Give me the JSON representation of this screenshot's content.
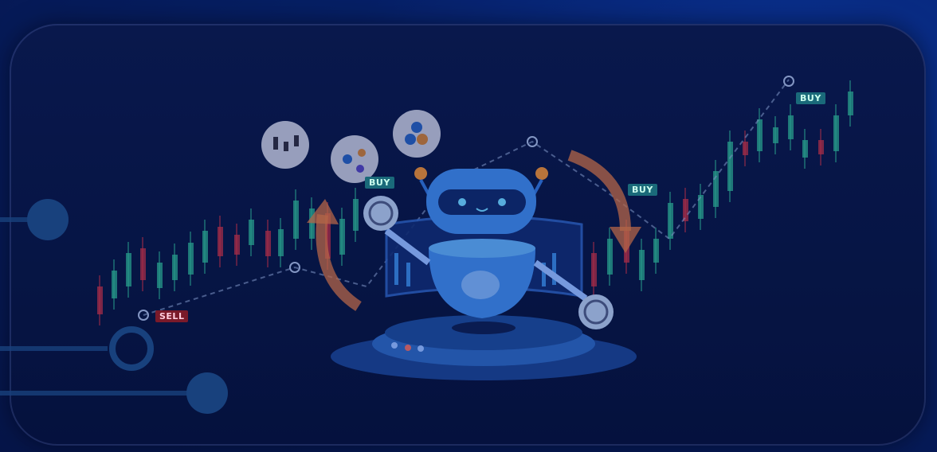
{
  "tags": {
    "buy1": "BUY",
    "buy2": "BUY",
    "buy3": "BUY",
    "sell1": "SELL"
  },
  "colors": {
    "accent": "#3aa0ff",
    "up": "#2fb89a",
    "down": "#c8334a",
    "arrow": "#d9784a"
  }
}
